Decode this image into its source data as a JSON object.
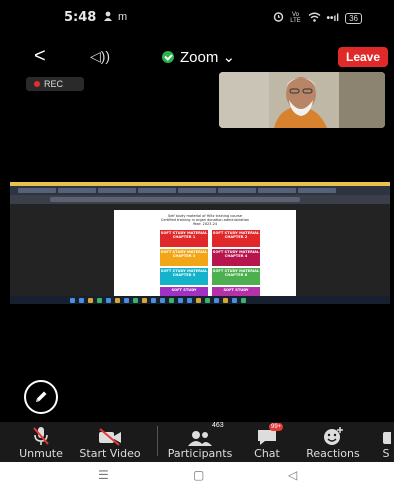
{
  "status_bar": {
    "time": "5:48",
    "left_icons": [
      "person-icon",
      "m"
    ],
    "right_icons": [
      "alarm-icon",
      "volte",
      "wifi-icon",
      "signal-icon"
    ],
    "volte_text": "Vo LTE",
    "signal_text": "••ıl",
    "battery": "36"
  },
  "meeting": {
    "back": "<",
    "speaker": "◁))",
    "title": "Zoom ⌄",
    "leave": "Leave",
    "rec": "REC"
  },
  "shared_screen": {
    "doc_heading": [
      "Self study material of Hiltz training course",
      "Certified training in organ donation administration",
      "Year: 2023-24"
    ],
    "tiles": [
      {
        "label": "SOFT STUDY MATERIAL CHAPTER 1",
        "color": "#e0282b"
      },
      {
        "label": "SOFT STUDY MATERIAL CHAPTER 2",
        "color": "#e0282b"
      },
      {
        "label": "SOFT STUDY MATERIAL CHAPTER 3",
        "color": "#f2a517"
      },
      {
        "label": "SOFT STUDY MATERIAL CHAPTER 4",
        "color": "#b8154f"
      },
      {
        "label": "SOFT STUDY MATERIAL CHAPTER 5",
        "color": "#15b3c9"
      },
      {
        "label": "SOFT STUDY MATERIAL CHAPTER 6",
        "color": "#4caf50"
      },
      {
        "label": "SOFT STUDY",
        "color": "#a031c4"
      },
      {
        "label": "SOFT STUDY",
        "color": "#b531a8"
      }
    ]
  },
  "toolbar": {
    "unmute": "Unmute",
    "start_video": "Start Video",
    "participants": "Participants",
    "participants_count": "463",
    "chat": "Chat",
    "chat_badge": "99+",
    "reactions": "Reactions",
    "share": "S"
  },
  "nav": {
    "recents": "☰",
    "home": "▢",
    "back": "◁"
  }
}
